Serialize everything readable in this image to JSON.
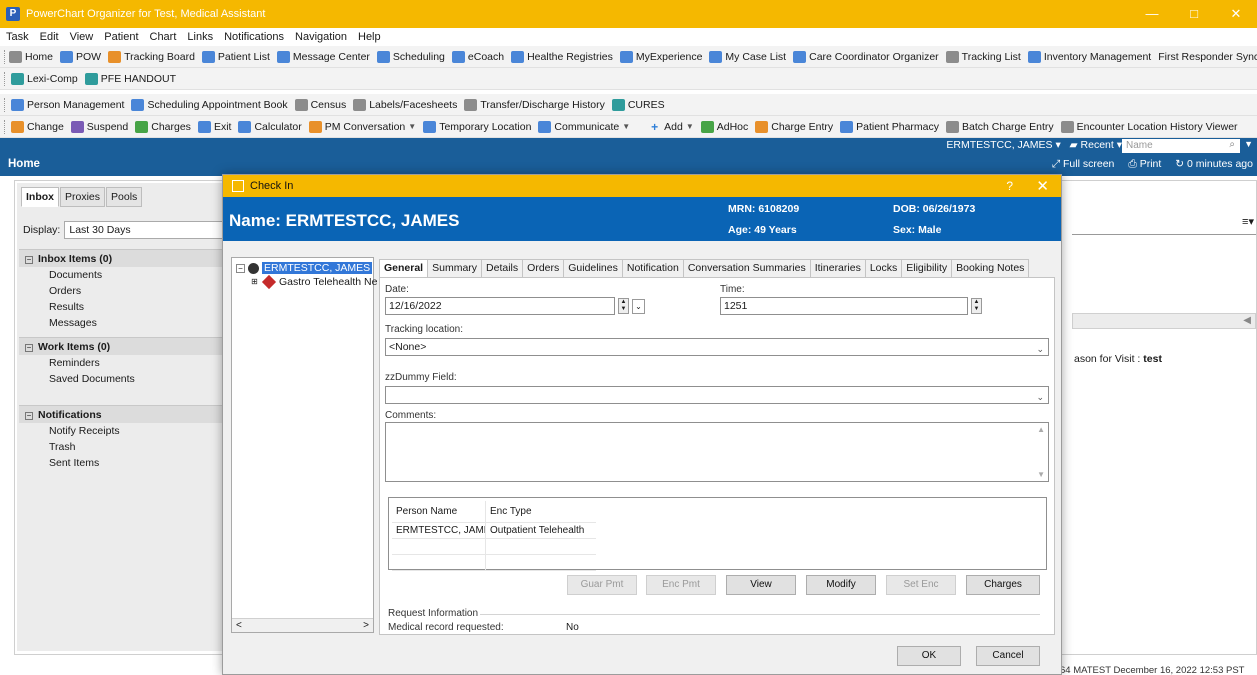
{
  "window": {
    "title": "PowerChart Organizer for Test, Medical Assistant",
    "controls": {
      "minimize": "—",
      "maximize": "□",
      "close": "✕"
    }
  },
  "menu": [
    "Task",
    "Edit",
    "View",
    "Patient",
    "Chart",
    "Links",
    "Notifications",
    "Navigation",
    "Help"
  ],
  "toolbar1": [
    {
      "label": "Home",
      "icon": "home-icon"
    },
    {
      "label": "POW",
      "icon": "app-icon"
    },
    {
      "label": "Tracking Board",
      "icon": "tracking-icon"
    },
    {
      "label": "Patient List",
      "icon": "patient-list-icon"
    },
    {
      "label": "Message Center",
      "icon": "message-icon"
    },
    {
      "label": "Scheduling",
      "icon": "calendar-icon"
    },
    {
      "label": "eCoach",
      "icon": "app-icon"
    },
    {
      "label": "Healthe Registries",
      "icon": "app-icon"
    },
    {
      "label": "MyExperience",
      "icon": "app-icon"
    },
    {
      "label": "My Case List",
      "icon": "app-icon"
    },
    {
      "label": "Care Coordinator Organizer",
      "icon": "app-icon"
    },
    {
      "label": "Tracking List",
      "icon": "list-icon"
    },
    {
      "label": "Inventory Management",
      "icon": "app-icon"
    },
    {
      "label": "First Responder Synchronization",
      "icon": ""
    }
  ],
  "toolbar2": [
    {
      "label": "Lexi-Comp",
      "icon": "search-icon"
    },
    {
      "label": "PFE HANDOUT",
      "icon": "search-icon"
    }
  ],
  "toolbar3": [
    {
      "label": "Person Management",
      "icon": "person-icon"
    },
    {
      "label": "Scheduling Appointment Book",
      "icon": "calendar-icon"
    },
    {
      "label": "Census",
      "icon": "census-icon"
    },
    {
      "label": "Labels/Facesheets",
      "icon": "labels-icon"
    },
    {
      "label": "Transfer/Discharge History",
      "icon": "transfer-icon"
    },
    {
      "label": "CURES",
      "icon": "search-icon"
    }
  ],
  "toolbar4": [
    {
      "label": "Change",
      "icon": "change-icon"
    },
    {
      "label": "Suspend",
      "icon": "suspend-icon"
    },
    {
      "label": "Charges",
      "icon": "charges-icon"
    },
    {
      "label": "Exit",
      "icon": "exit-icon"
    },
    {
      "label": "Calculator",
      "icon": "calculator-icon"
    },
    {
      "label": "PM Conversation",
      "icon": "conversation-icon",
      "dropdown": true
    },
    {
      "label": "Temporary Location",
      "icon": "location-icon"
    },
    {
      "label": "Communicate",
      "icon": "communicate-icon",
      "dropdown": true
    },
    {
      "label": "Add",
      "icon": "add-icon",
      "dropdown": true
    },
    {
      "label": "AdHoc",
      "icon": "adhoc-icon"
    },
    {
      "label": "Charge Entry",
      "icon": "charge-entry-icon"
    },
    {
      "label": "Patient Pharmacy",
      "icon": "pharmacy-icon"
    },
    {
      "label": "Batch Charge Entry",
      "icon": "batch-icon"
    },
    {
      "label": "Encounter Location History Viewer",
      "icon": "history-icon"
    }
  ],
  "recent_bar": {
    "patient": "ERMTESTCC, JAMES",
    "recent": "Recent",
    "search_placeholder": "Name"
  },
  "home_bar": {
    "title": "Home",
    "full_screen": "Full screen",
    "print": "Print",
    "refresh": "0 minutes ago"
  },
  "inbox": {
    "tabs": [
      "Inbox",
      "Proxies",
      "Pools"
    ],
    "display_label": "Display:",
    "display_value": "Last 30 Days",
    "groups": [
      {
        "title": "Inbox Items (0)",
        "items": [
          "Documents",
          "Orders",
          "Results",
          "Messages"
        ]
      },
      {
        "title": "Work Items (0)",
        "items": [
          "Reminders",
          "Saved Documents"
        ]
      },
      {
        "title": "Notifications",
        "items": [
          "Notify Receipts",
          "Trash",
          "Sent Items"
        ]
      }
    ]
  },
  "right_panel": {
    "reason_label": "ason for Visit :",
    "reason_value": "test"
  },
  "status_bar": "64  MATEST  December 16, 2022  12:53 PST",
  "dialog": {
    "title": "Check In",
    "help": "?",
    "close": "✕",
    "banner": {
      "name": "Name: ERMTESTCC, JAMES",
      "mrn": "MRN: 6108209",
      "dob": "DOB: 06/26/1973",
      "age": "Age:  49 Years",
      "sex": "Sex: Male"
    },
    "tree": {
      "root": "ERMTESTCC, JAMES",
      "child": "Gastro Telehealth Ne"
    },
    "tabs": [
      "General",
      "Summary",
      "Details",
      "Orders",
      "Guidelines",
      "Notification",
      "Conversation Summaries",
      "Itineraries",
      "Locks",
      "Eligibility",
      "Booking Notes"
    ],
    "general": {
      "date_label": "Date:",
      "date_value": "12/16/2022",
      "time_label": "Time:",
      "time_value": "1251",
      "tracking_label": "Tracking location:",
      "tracking_value": "<None>",
      "dummy_label": "zzDummy Field:",
      "dummy_value": "",
      "comments_label": "Comments:",
      "grid_headers": [
        "Person Name",
        "Enc Type"
      ],
      "grid_rows": [
        [
          "ERMTESTCC, JAMES",
          "Outpatient Telehealth"
        ]
      ],
      "buttons": [
        {
          "label": "Guar Pmt",
          "enabled": false
        },
        {
          "label": "Enc Pmt",
          "enabled": false
        },
        {
          "label": "View",
          "enabled": true
        },
        {
          "label": "Modify",
          "enabled": true
        },
        {
          "label": "Set Enc",
          "enabled": false
        },
        {
          "label": "Charges",
          "enabled": true
        }
      ],
      "request_label": "Request Information",
      "medical_record_label": "Medical record requested:",
      "medical_record_value": "No"
    },
    "ok": "OK",
    "cancel": "Cancel"
  },
  "colors": {
    "title_bar": "#f5b800",
    "nav_bar": "#1a5e99",
    "banner": "#0a64b5",
    "selection": "#3277d8"
  }
}
